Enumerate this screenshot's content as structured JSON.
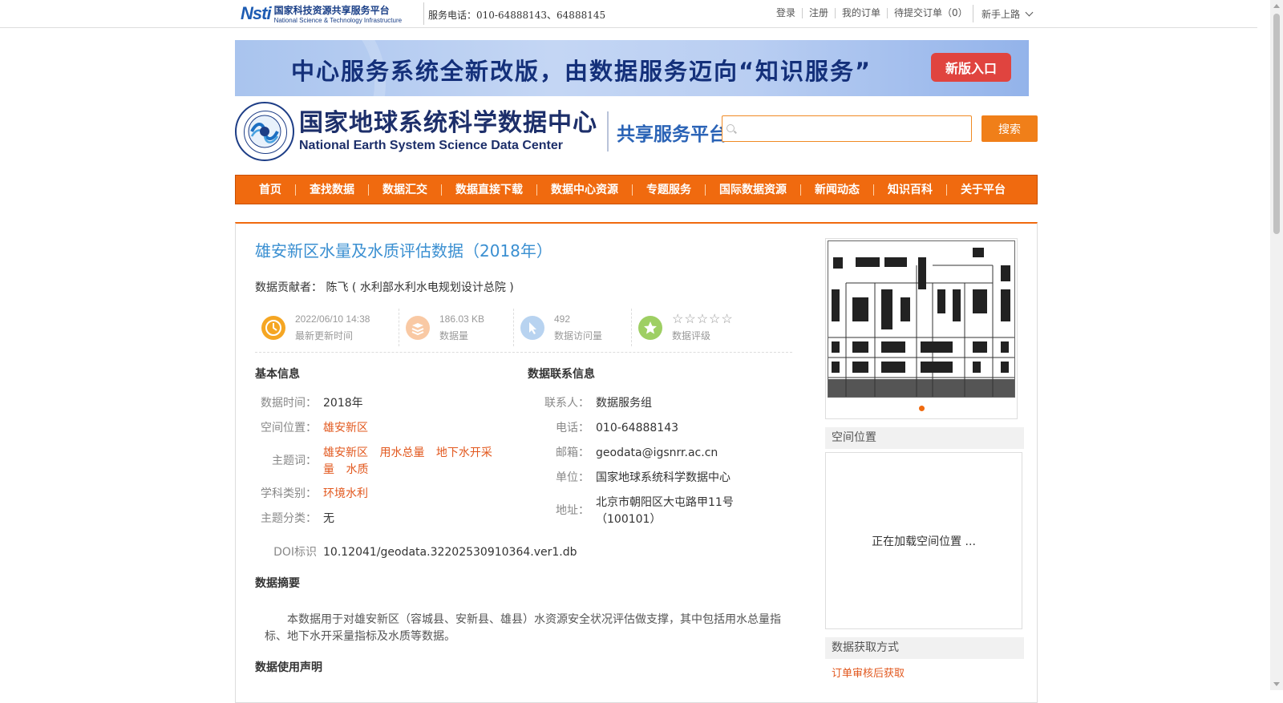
{
  "topbar": {
    "nsti_cn": "国家科技资源共享服务平台",
    "nsti_en": "National Science & Technology Infrastructure",
    "nsti_mark": "Nsti",
    "service_phone": "服务电话：010-64888143、64888145",
    "links": [
      "登录",
      "注册",
      "我的订单",
      "待提交订单（0）"
    ],
    "newbie": "新手上路"
  },
  "banner": {
    "text": "中心服务系统全新改版，由数据服务迈向“知识服务”",
    "button": "新版入口"
  },
  "brand": {
    "name_cn": "国家地球系统科学数据中心",
    "name_en": "National Earth System Science Data Center",
    "platform": "共享服务平台"
  },
  "search": {
    "value": "",
    "button": "搜索"
  },
  "nav": [
    "首页",
    "查找数据",
    "数据汇交",
    "数据直接下载",
    "数据中心资源",
    "专题服务",
    "国际数据资源",
    "新闻动态",
    "知识百科",
    "关于平台"
  ],
  "dataset": {
    "title": "雄安新区水量及水质评估数据（2018年）",
    "contributor_label": "数据贡献者：",
    "contributor": "陈飞 ( 水利部水利水电规划设计总院 )"
  },
  "stats": [
    {
      "value": "2022/06/10 14:38",
      "label": "最新更新时间",
      "icon": "clock-icon",
      "color": "#f5a623"
    },
    {
      "value": "186.03 KB",
      "label": "数据量",
      "icon": "layers-icon",
      "color": "#f9c9a4"
    },
    {
      "value": "492",
      "label": "数据访问量",
      "icon": "pointer-icon",
      "color": "#b8d3f0"
    },
    {
      "stars": "☆☆☆☆☆",
      "label": "数据评级",
      "icon": "star-badge-icon",
      "color": "#9ecf63",
      "rating": 0
    }
  ],
  "basic_info": {
    "heading": "基本信息",
    "time_label": "数据时间：",
    "time": "2018年",
    "location_label": "空间位置：",
    "location": "雄安新区",
    "keywords_label": "主题词：",
    "keywords": [
      "雄安新区",
      "用水总量",
      "地下水开采量",
      "水质"
    ],
    "subject_label": "学科类别：",
    "subject": "环境水利",
    "category_label": "主题分类：",
    "category": "无",
    "doi_label": "DOI标识",
    "doi": "10.12041/geodata.32202530910364.ver1.db"
  },
  "contact_info": {
    "heading": "数据联系信息",
    "contact_label": "联系人：",
    "contact": "数据服务组",
    "phone_label": "电话：",
    "phone": "010-64888143",
    "email_label": "邮箱：",
    "email": "geodata@igsnrr.ac.cn",
    "unit_label": "单位：",
    "unit": "国家地球系统科学数据中心",
    "address_label": "地址：",
    "address": "北京市朝阳区大屯路甲11号（100101）"
  },
  "abstract": {
    "heading": "数据摘要",
    "text": "本数据用于对雄安新区（容城县、安新县、雄县）水资源安全状况评估做支撑，其中包括用水总量指标、地下水开采量指标及水质等数据。"
  },
  "usage": {
    "heading": "数据使用声明"
  },
  "sidebar": {
    "spatial_heading": "空间位置",
    "map_loading": "正在加载空间位置 ...",
    "access_heading": "数据获取方式",
    "access_link": "订单审核后获取"
  }
}
